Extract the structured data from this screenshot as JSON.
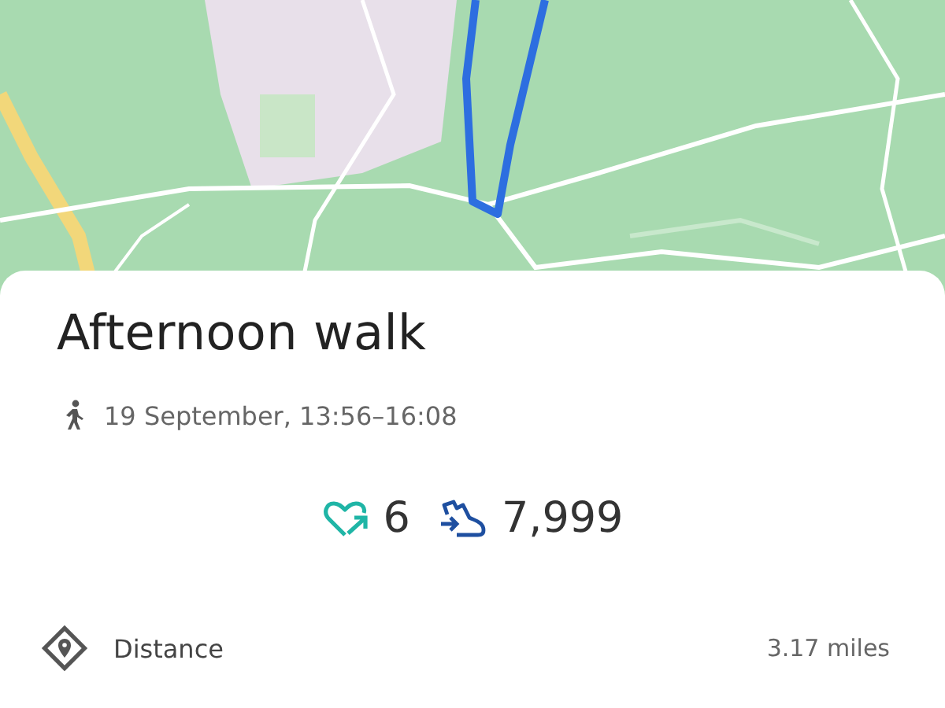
{
  "activity": {
    "title": "Afternoon walk",
    "when": "19 September, 13:56–16:08"
  },
  "stats": [
    {
      "kind": "heart_points",
      "value": "6"
    },
    {
      "kind": "steps",
      "value": "7,999"
    }
  ],
  "metrics": [
    {
      "label": "Distance",
      "value": "3.17 miles"
    }
  ]
}
